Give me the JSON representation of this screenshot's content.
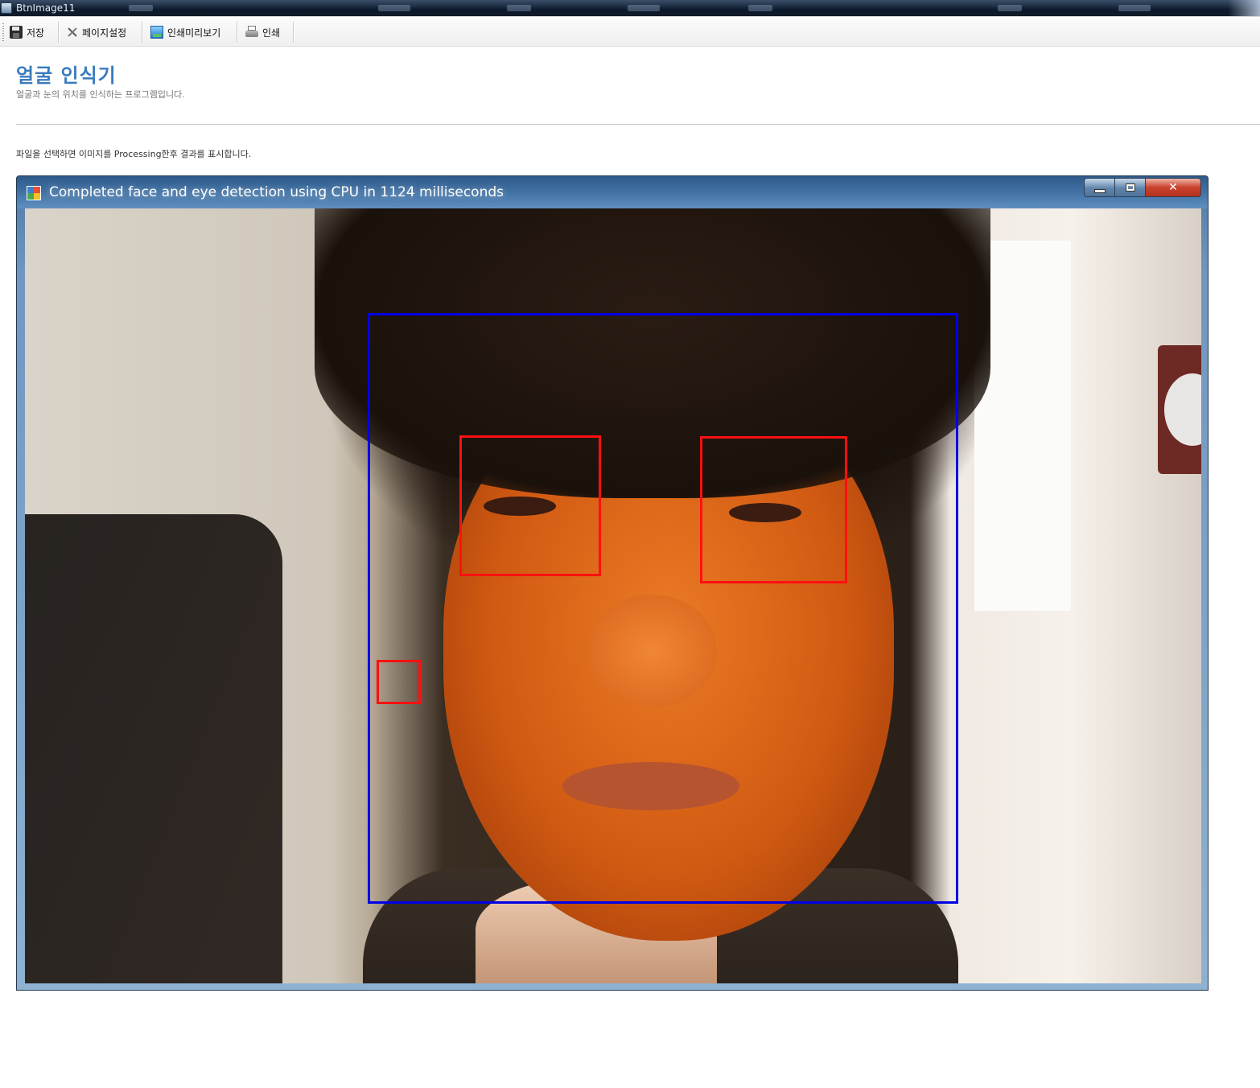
{
  "app": {
    "window_title": "BtnImage11"
  },
  "toolbar": {
    "items": [
      {
        "label": "저장",
        "icon": "save-icon"
      },
      {
        "label": "페이지설정",
        "icon": "page-setup-icon"
      },
      {
        "label": "인쇄미리보기",
        "icon": "print-preview-icon"
      },
      {
        "label": "인쇄",
        "icon": "printer-icon"
      }
    ]
  },
  "page": {
    "title": "얼굴 인식기",
    "subtitle": "얼굴과 눈의 위치를 인식하는 프로그램입니다.",
    "instruction": "파일을 선택하면 이미지를 Processing한후 결과를 표시합니다."
  },
  "result_window": {
    "title": "Completed face and eye detection using CPU in 1124 milliseconds",
    "controls": [
      "minimize",
      "maximize",
      "close"
    ],
    "detections": {
      "face_box_color": "#0000e6",
      "eye_box_color": "#ff1010",
      "face_count": 1,
      "eye_count": 3
    }
  }
}
